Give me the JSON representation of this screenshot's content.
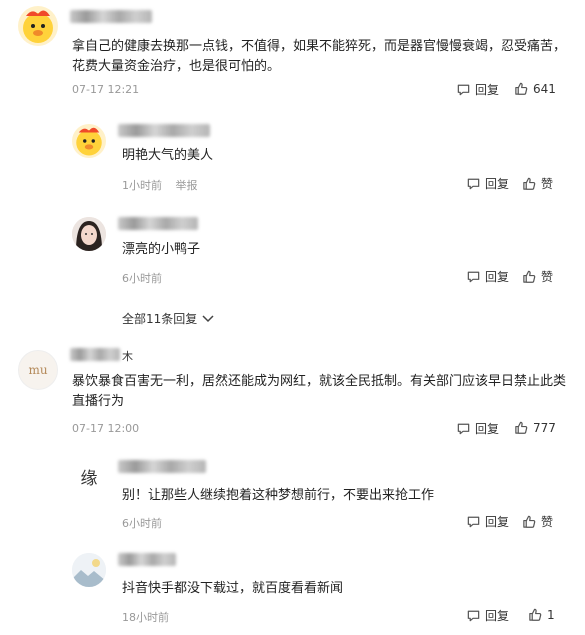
{
  "comments": [
    {
      "text_line1": "拿自己的健康去换那一点钱，不值得，如果不能猝死，而是器官慢慢衰竭，忍受痛苦，",
      "text_line2": "花费大量资金治疗，也是很可怕的。",
      "time": "07-17 12:21",
      "reply_label": "回复",
      "like_count": "641"
    },
    {
      "text": "明艳大气的美人",
      "time": "1小时前",
      "report_label": "举报",
      "reply_label": "回复",
      "like_label": "赞"
    },
    {
      "text": "漂亮的小鸭子",
      "time": "6小时前",
      "reply_label": "回复",
      "like_label": "赞"
    },
    {
      "expand_label": "全部11条回复"
    },
    {
      "name_tail": "木",
      "text_line1": "暴饮暴食百害无一利，居然还能成为网红，就该全民抵制。有关部门应该早日禁止此类",
      "text_line2": "直播行为",
      "time": "07-17 12:00",
      "reply_label": "回复",
      "like_count": "777"
    },
    {
      "text": "别！让那些人继续抱着这种梦想前行，不要出来抢工作",
      "time": "6小时前",
      "reply_label": "回复",
      "like_label": "赞"
    },
    {
      "text": "抖音快手都没下载过，就百度看看新闻",
      "time": "18小时前",
      "reply_label": "回复",
      "like_count": "1"
    }
  ],
  "avatar_text": {
    "mu": "mu",
    "yuan": "缘"
  },
  "colors": {
    "meta": "#999999",
    "text": "#222222",
    "duck_yellow": "#ffd23a",
    "duck_red": "#f04a2a"
  }
}
